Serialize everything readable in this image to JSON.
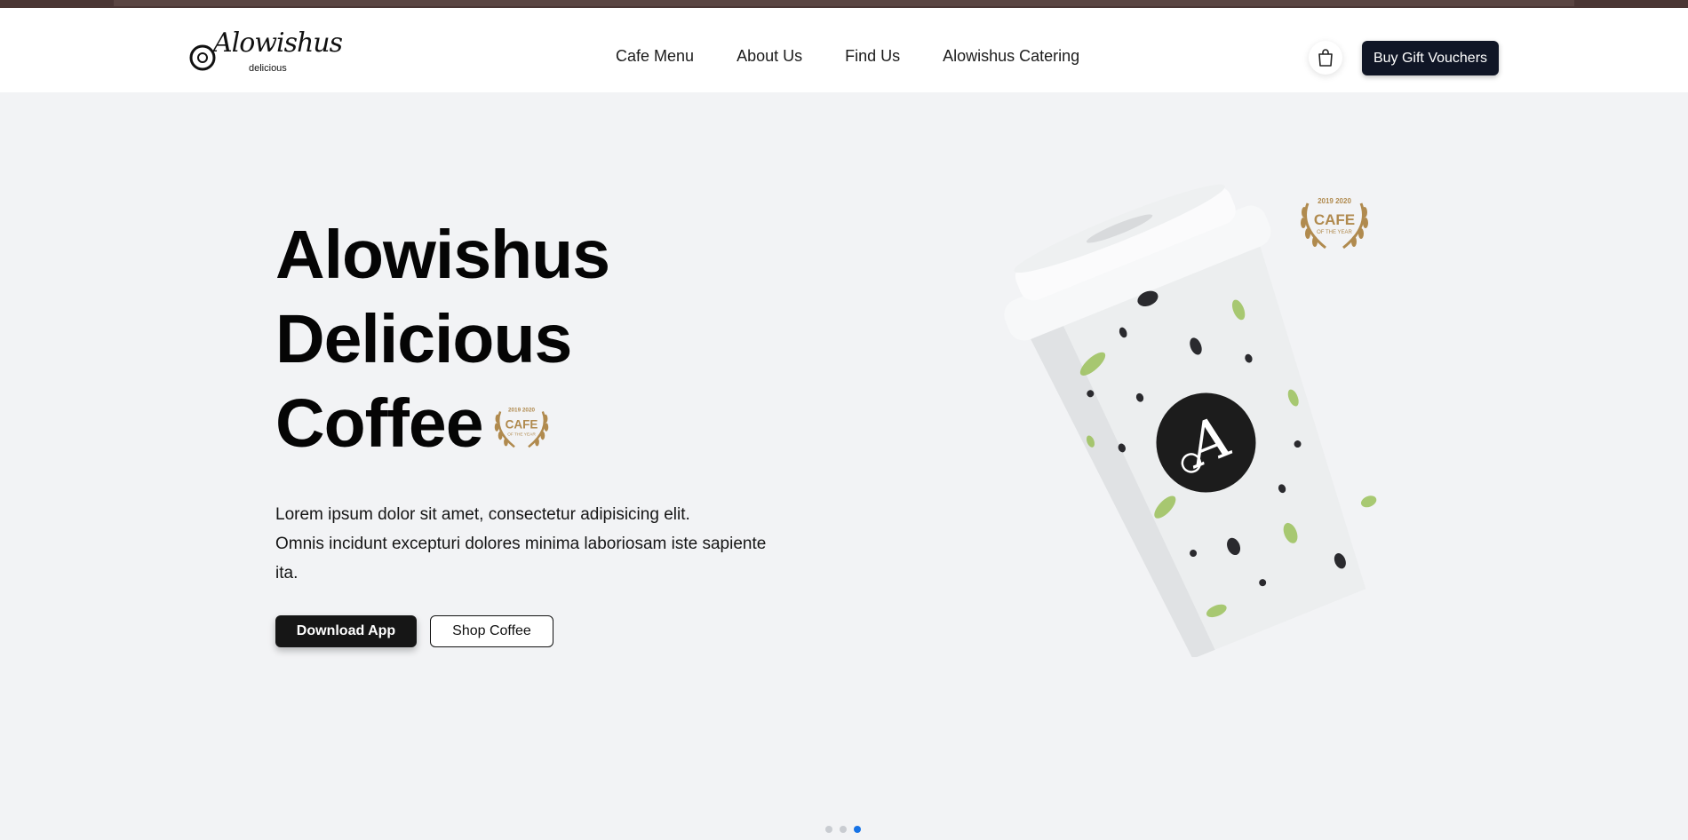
{
  "brand": {
    "name": "Alowishus",
    "sub": "delicious"
  },
  "nav": [
    {
      "label": "Cafe Menu"
    },
    {
      "label": "About Us"
    },
    {
      "label": "Find Us"
    },
    {
      "label": "Alowishus Catering"
    }
  ],
  "header": {
    "cart_icon": "shopping-bag-icon",
    "gift_label": "Buy Gift Vouchers"
  },
  "hero": {
    "title_lines": [
      "Alowishus",
      "Delicious",
      "Coffee"
    ],
    "description_line1": "Lorem ipsum dolor sit amet, consectetur adipisicing elit.",
    "description_line2": "Omnis incidunt excepturi dolores minima laboriosam iste sapiente ita.",
    "download_label": "Download App",
    "shop_label": "Shop Coffee"
  },
  "award": {
    "years": "2019 2020",
    "title": "CAFE",
    "sub": "OF THE YEAR"
  },
  "carousel": {
    "active_index": 2,
    "count": 3
  },
  "colors": {
    "accent_dark": "#101626",
    "button_dark": "#161616",
    "active_dot": "#1773e6",
    "award_gold": "#b08a4e"
  }
}
